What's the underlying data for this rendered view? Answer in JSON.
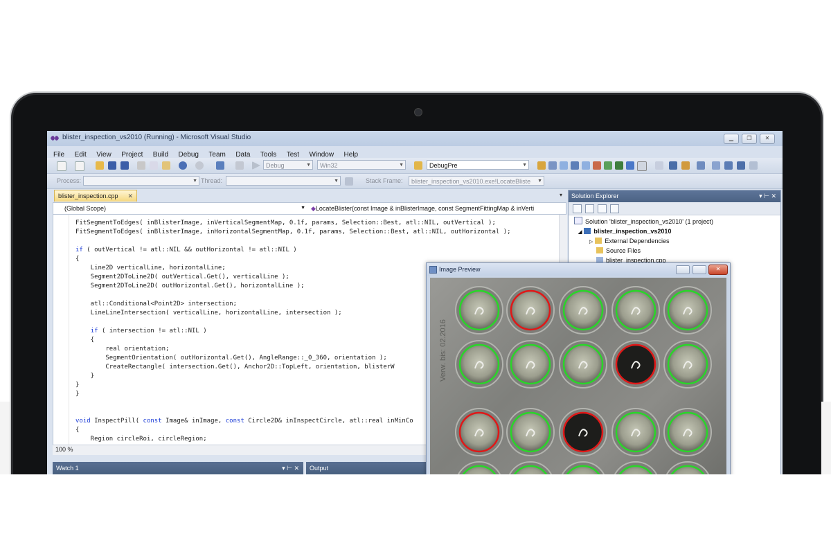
{
  "window": {
    "title": "blister_inspection_vs2010 (Running) - Microsoft Visual Studio",
    "buttons": [
      "minimize",
      "restore",
      "close"
    ]
  },
  "menu": [
    "File",
    "Edit",
    "View",
    "Project",
    "Build",
    "Debug",
    "Team",
    "Data",
    "Tools",
    "Test",
    "Window",
    "Help"
  ],
  "toolbar": {
    "solution_config": "Debug",
    "platform": "Win32",
    "debug_combo": "DebugPre"
  },
  "debug_toolbar": {
    "process_label": "Process:",
    "thread_label": "Thread:",
    "stack_frame_label": "Stack Frame:",
    "stack_frame_value": "blister_inspection_vs2010.exe!LocateBliste"
  },
  "editor": {
    "tab_label": "blister_inspection.cpp",
    "scope_combo": "(Global Scope)",
    "member_combo": "LocateBlister(const Image & inBlisterImage, const SegmentFittingMap & inVerti",
    "zoom": "100 %",
    "code_lines": [
      "FitSegmentToEdges( inBlisterImage, inVerticalSegmentMap, 0.1f, params, Selection::Best, atl::NIL, outVertical );",
      "FitSegmentToEdges( inBlisterImage, inHorizontalSegmentMap, 0.1f, params, Selection::Best, atl::NIL, outHorizontal );",
      "",
      "if ( outVertical != atl::NIL && outHorizontal != atl::NIL )",
      "{",
      "    Line2D verticalLine, horizontalLine;",
      "    Segment2DToLine2D( outVertical.Get(), verticalLine );",
      "    Segment2DToLine2D( outHorizontal.Get(), horizontalLine );",
      "",
      "    atl::Conditional<Point2D> intersection;",
      "    LineLineIntersection( verticalLine, horizontalLine, intersection );",
      "",
      "    if ( intersection != atl::NIL )",
      "    {",
      "        real orientation;",
      "        SegmentOrientation( outHorizontal.Get(), AngleRange::_0_360, orientation );",
      "        CreateRectangle( intersection.Get(), Anchor2D::TopLeft, orientation, blisterW",
      "    }",
      "}",
      "}",
      "",
      "",
      "void InspectPill( const Image& inImage, const Circle2D& inInspectCircle, atl::real inMinCo",
      "{",
      "    Region circleRoi, circleRegion;"
    ]
  },
  "bottom_panels": {
    "watch": "Watch 1",
    "output": "Output"
  },
  "solution_explorer": {
    "title": "Solution Explorer",
    "items": [
      "Solution 'blister_inspection_vs2010' (1 project)",
      "blister_inspection_vs2010",
      "External Dependencies",
      "Source Files",
      "blister_inspection.cpp"
    ]
  },
  "image_preview": {
    "title": "Image Preview",
    "imprint_text": "Verw. bis: 02.2016",
    "pills": [
      [
        "good",
        "bad",
        "good",
        "good",
        "good"
      ],
      [
        "good",
        "good",
        "good",
        "bad",
        "good"
      ],
      [
        "bad",
        "good",
        "bad",
        "good",
        "good"
      ],
      [
        "good",
        "good",
        "good",
        "good",
        "good"
      ]
    ],
    "colors": {
      "good": "#29d629",
      "bad": "#e01818"
    }
  }
}
